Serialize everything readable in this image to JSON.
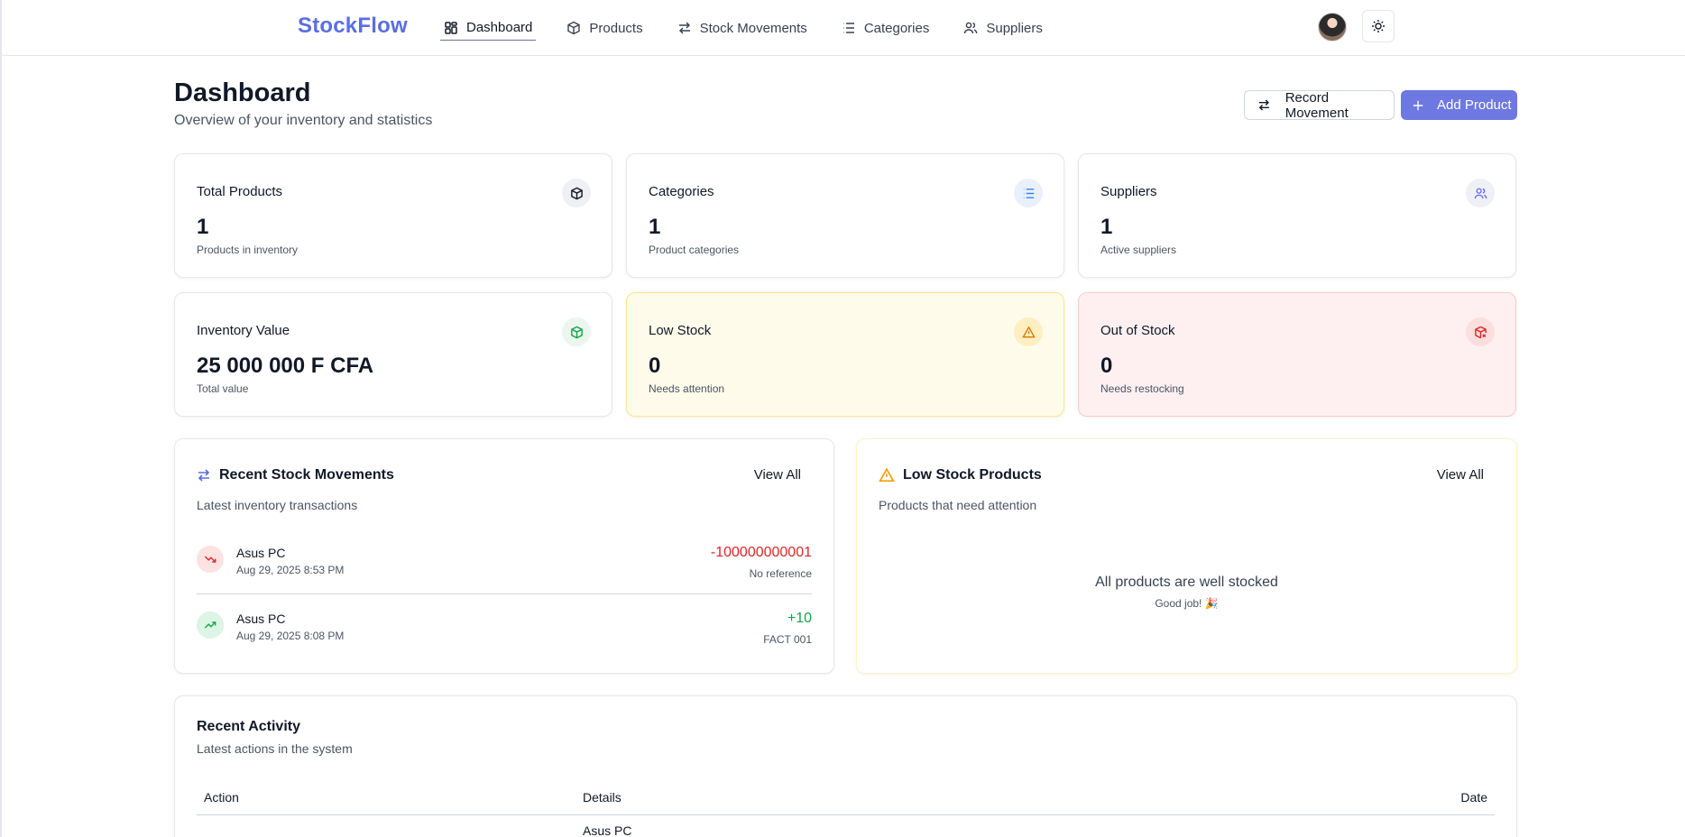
{
  "nav": {
    "brand": "StockFlow",
    "links": [
      {
        "label": "Dashboard",
        "icon": "dashboard-icon"
      },
      {
        "label": "Products",
        "icon": "box-icon"
      },
      {
        "label": "Stock Movements",
        "icon": "arrows-icon"
      },
      {
        "label": "Categories",
        "icon": "list-icon"
      },
      {
        "label": "Suppliers",
        "icon": "users-icon"
      }
    ],
    "active": "Dashboard"
  },
  "header": {
    "title": "Dashboard",
    "subtitle": "Overview of your inventory and statistics",
    "record_movement_label": "Record Movement",
    "add_product_label": "Add Product"
  },
  "stats": [
    {
      "title": "Total Products",
      "value": "1",
      "desc": "Products in inventory",
      "icon": "box-icon"
    },
    {
      "title": "Categories",
      "value": "1",
      "desc": "Product categories",
      "icon": "list-icon"
    },
    {
      "title": "Suppliers",
      "value": "1",
      "desc": "Active suppliers",
      "icon": "users-icon"
    },
    {
      "title": "Inventory Value",
      "value": "25 000 000 F CFA",
      "desc": "Total value",
      "icon": "box-icon"
    },
    {
      "title": "Low Stock",
      "value": "0",
      "desc": "Needs attention",
      "icon": "warning-icon"
    },
    {
      "title": "Out of Stock",
      "value": "0",
      "desc": "Needs restocking",
      "icon": "box-x-icon"
    }
  ],
  "recent_movements": {
    "title": "Recent Stock Movements",
    "subtitle": "Latest inventory transactions",
    "view_all": "View All",
    "items": [
      {
        "product": "Asus PC",
        "date": "Aug 29, 2025 8:53 PM",
        "qty": "-100000000001",
        "ref": "No reference",
        "direction": "out"
      },
      {
        "product": "Asus PC",
        "date": "Aug 29, 2025 8:08 PM",
        "qty": "+10",
        "ref": "FACT 001",
        "direction": "in"
      }
    ]
  },
  "low_stock": {
    "title": "Low Stock Products",
    "subtitle": "Products that need attention",
    "view_all": "View All",
    "empty_title": "All products are well stocked",
    "empty_sub": "Good job! 🎉"
  },
  "activity": {
    "title": "Recent Activity",
    "subtitle": "Latest actions in the system",
    "columns": [
      "Action",
      "Details",
      "Date"
    ],
    "first_row_details": "Asus PC"
  },
  "colors": {
    "brand": "#5b6ee1",
    "primary": "#6d78e0",
    "danger": "#dc2626",
    "success": "#16a34a",
    "warning": "#f59e0b"
  }
}
